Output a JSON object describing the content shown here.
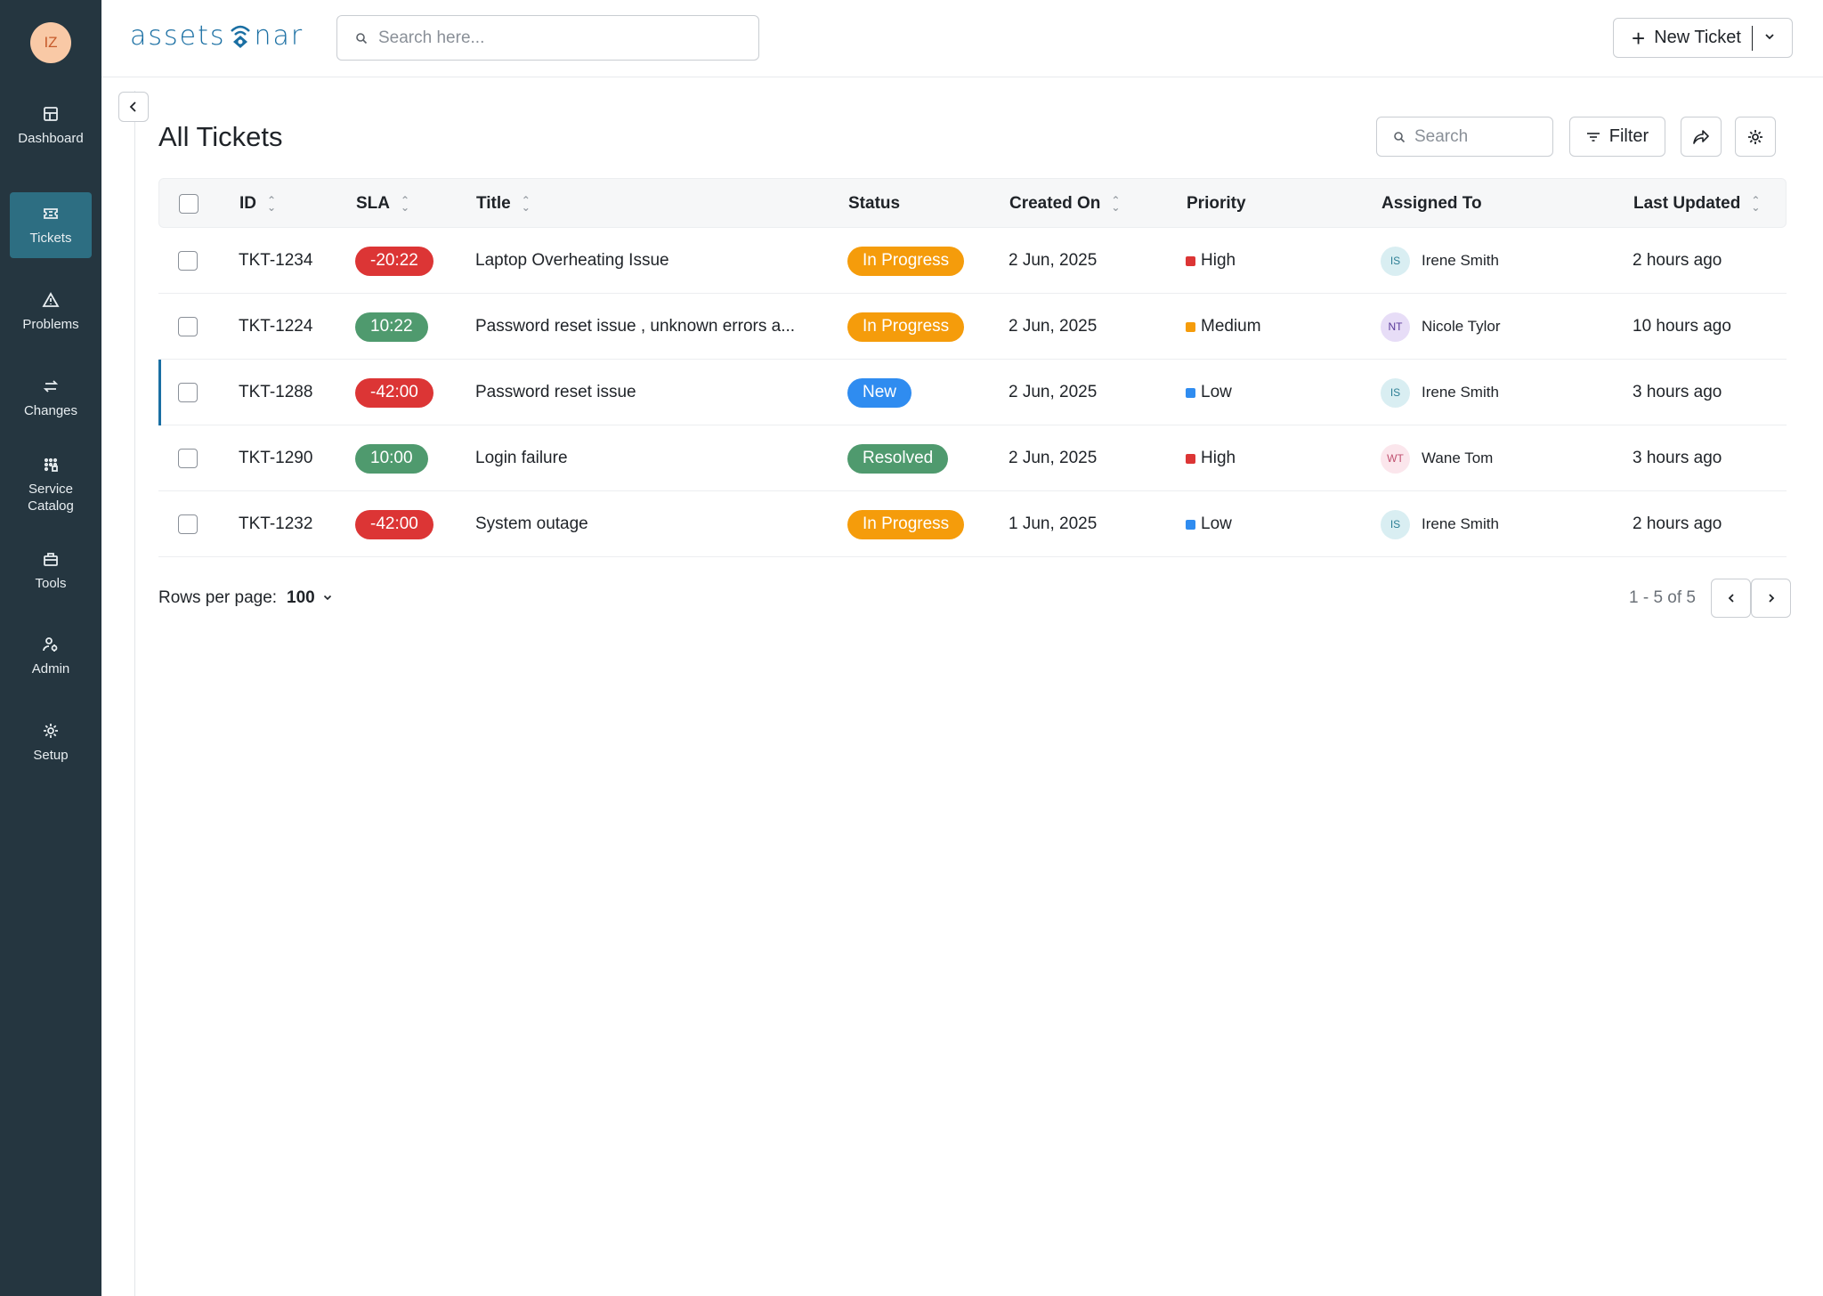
{
  "user": {
    "initials": "IZ"
  },
  "sidebar": {
    "items": [
      {
        "label": "Dashboard",
        "icon": "dashboard-icon",
        "active": false
      },
      {
        "label": "Tickets",
        "icon": "ticket-icon",
        "active": true
      },
      {
        "label": "Problems",
        "icon": "warning-icon",
        "active": false
      },
      {
        "label": "Changes",
        "icon": "swap-icon",
        "active": false
      },
      {
        "label": "Service Catalog",
        "icon": "catalog-icon",
        "active": false
      },
      {
        "label": "Tools",
        "icon": "toolbox-icon",
        "active": false
      },
      {
        "label": "Admin",
        "icon": "admin-icon",
        "active": false
      },
      {
        "label": "Setup",
        "icon": "gear-icon",
        "active": false
      }
    ]
  },
  "header": {
    "logo_left": "assets",
    "logo_right": "nar",
    "search_placeholder": "Search here...",
    "new_ticket_label": "New Ticket"
  },
  "page": {
    "title": "All Tickets",
    "search_placeholder": "Search",
    "filter_label": "Filter"
  },
  "table": {
    "columns": [
      "ID",
      "SLA",
      "Title",
      "Status",
      "Created On",
      "Priority",
      "Assigned To",
      "Last Updated"
    ],
    "rows": [
      {
        "id": "TKT-1234",
        "sla": "-20:22",
        "sla_state": "breached",
        "title": "Laptop Overheating Issue",
        "status": "In Progress",
        "created": "2 Jun, 2025",
        "priority": "High",
        "assignee_initials": "IS",
        "assignee": "Irene Smith",
        "updated": "2 hours ago"
      },
      {
        "id": "TKT-1224",
        "sla": "10:22",
        "sla_state": "ok",
        "title": "Password reset issue , unknown errors a...",
        "status": "In Progress",
        "created": "2 Jun, 2025",
        "priority": "Medium",
        "assignee_initials": "NT",
        "assignee": "Nicole Tylor",
        "updated": "10 hours ago"
      },
      {
        "id": "TKT-1288",
        "sla": "-42:00",
        "sla_state": "breached",
        "title": "Password reset issue",
        "status": "New",
        "created": "2 Jun, 2025",
        "priority": "Low",
        "assignee_initials": "IS",
        "assignee": "Irene Smith",
        "updated": "3 hours ago"
      },
      {
        "id": "TKT-1290",
        "sla": "10:00",
        "sla_state": "ok",
        "title": "Login failure",
        "status": "Resolved",
        "created": "2 Jun, 2025",
        "priority": "High",
        "assignee_initials": "WT",
        "assignee": "Wane Tom",
        "updated": "3 hours ago"
      },
      {
        "id": "TKT-1232",
        "sla": "-42:00",
        "sla_state": "breached",
        "title": "System outage",
        "status": "In Progress",
        "created": "1 Jun, 2025",
        "priority": "Low",
        "assignee_initials": "IS",
        "assignee": "Irene Smith",
        "updated": "2 hours ago"
      }
    ]
  },
  "pagination": {
    "rows_per_page_label": "Rows per page:",
    "rows_per_page": "100",
    "range": "1 - 5 of 5"
  },
  "colors": {
    "sidebar_bg": "#253640",
    "sidebar_active": "#2d6e82",
    "sla_breached": "#dc3535",
    "sla_ok": "#4f9a6e",
    "status_in_progress": "#f59c0b",
    "status_new": "#2f8cf0",
    "status_resolved": "#4f9a6e",
    "priority_high": "#dc3535",
    "priority_medium": "#f59c0b",
    "priority_low": "#2f8cf0"
  }
}
